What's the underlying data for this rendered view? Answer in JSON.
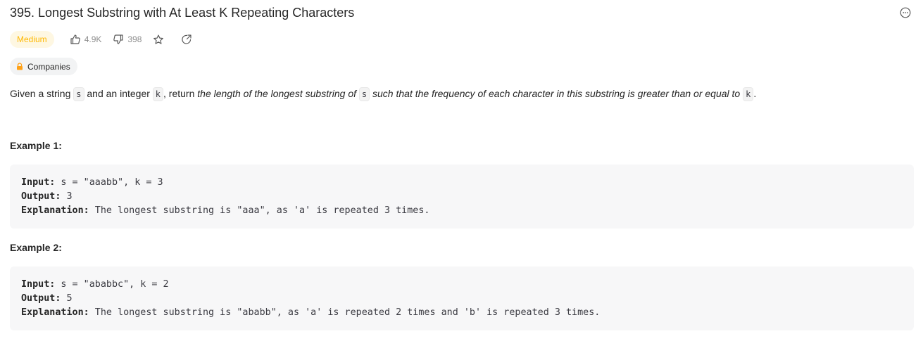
{
  "problem": {
    "title": "395. Longest Substring with At Least K Repeating Characters",
    "difficulty": "Medium",
    "likes": "4.9K",
    "dislikes": "398",
    "companies_label": "Companies"
  },
  "description": {
    "p1": "Given a string ",
    "code_s": "s",
    "p2": " and an integer ",
    "code_k": "k",
    "p3": ", return ",
    "em1": "the length of the longest substring of ",
    "code_s2": "s",
    "em2": " such that the frequency of each character in this substring is greater than or equal to ",
    "code_k2": "k",
    "p4": "."
  },
  "examples": [
    {
      "heading": "Example 1:",
      "input_label": "Input:",
      "input_value": " s = \"aaabb\", k = 3",
      "output_label": "Output:",
      "output_value": " 3",
      "explanation_label": "Explanation:",
      "explanation_value": " The longest substring is \"aaa\", as 'a' is repeated 3 times."
    },
    {
      "heading": "Example 2:",
      "input_label": "Input:",
      "input_value": " s = \"ababbc\", k = 2",
      "output_label": "Output:",
      "output_value": " 5",
      "explanation_label": "Explanation:",
      "explanation_value": " The longest substring is \"ababb\", as 'a' is repeated 2 times and 'b' is repeated 3 times."
    }
  ],
  "icons": {
    "more": "more-options-icon",
    "like": "thumbs-up-icon",
    "dislike": "thumbs-down-icon",
    "favorite": "star-icon",
    "share": "share-icon",
    "lock": "lock-icon"
  },
  "colors": {
    "difficulty_text": "#ffb800",
    "difficulty_bg": "#fef7e2",
    "lock": "#ffa116"
  }
}
